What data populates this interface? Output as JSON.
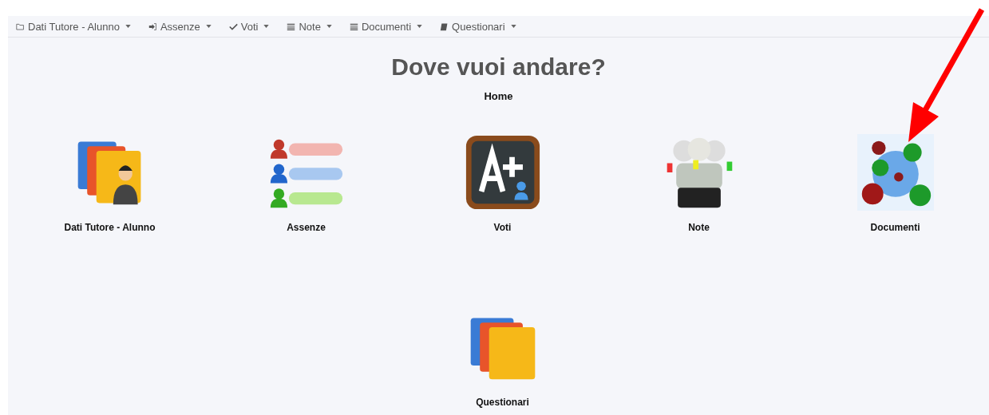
{
  "menu": [
    {
      "label": "Dati Tutore - Alunno",
      "kind": "folder"
    },
    {
      "label": "Assenze",
      "kind": "signin"
    },
    {
      "label": "Voti",
      "kind": "check"
    },
    {
      "label": "Note",
      "kind": "list"
    },
    {
      "label": "Documenti",
      "kind": "list"
    },
    {
      "label": "Questionari",
      "kind": "book"
    }
  ],
  "heading": "Dove vuoi andare?",
  "breadcrumb": "Home",
  "tiles": [
    {
      "label": "Dati Tutore - Alunno",
      "kind": "folders-person"
    },
    {
      "label": "Assenze",
      "kind": "people-bars"
    },
    {
      "label": "Voti",
      "kind": "chalkboard"
    },
    {
      "label": "Note",
      "kind": "figures"
    },
    {
      "label": "Documenti",
      "kind": "balls"
    },
    {
      "label": "Questionari",
      "kind": "folders"
    }
  ],
  "annotation": {
    "kind": "arrow"
  }
}
